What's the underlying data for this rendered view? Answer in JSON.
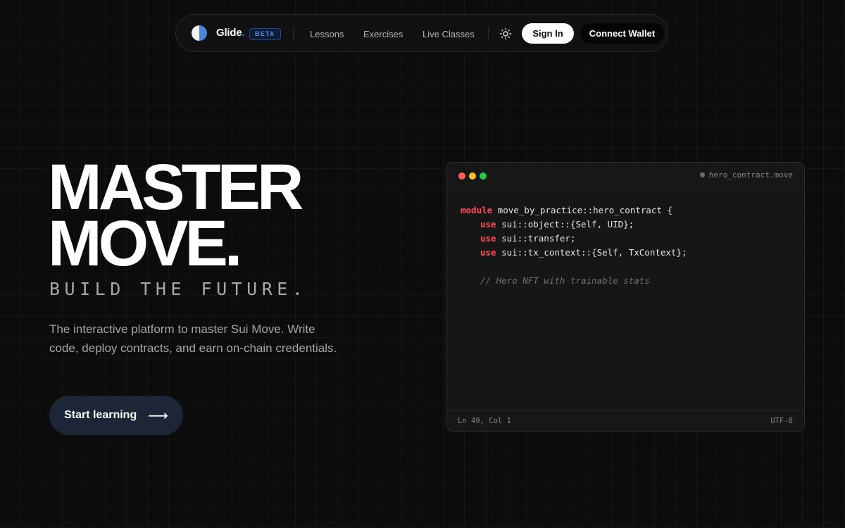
{
  "nav": {
    "brand": "Glide",
    "brand_dot": ".",
    "badge": "BETA",
    "links": [
      "Lessons",
      "Exercises",
      "Live Classes"
    ],
    "theme_icon": "sun-icon",
    "sign_in": "Sign In",
    "connect_wallet": "Connect Wallet"
  },
  "hero": {
    "title_line1": "MASTER",
    "title_line2": "MOVE.",
    "subtitle": "BUILD THE FUTURE.",
    "description": "The interactive platform to master Sui Move. Write code, deploy contracts, and earn on-chain credentials.",
    "cta_label": "Start learning",
    "cta_arrow": "⟶"
  },
  "editor": {
    "filename": "hero_contract.move",
    "lines": [
      {
        "kw": "module",
        "text": " move_by_practice::hero_contract {"
      },
      {
        "kw": "use",
        "text": " sui::object::{Self, UID};"
      },
      {
        "kw": "use",
        "text": " sui::transfer;"
      },
      {
        "kw": "use",
        "text": " sui::tx_context::{Self, TxContext};"
      }
    ],
    "comment": "// Hero NFT with trainable stats",
    "cursor_position": "Ln 49, Col 1",
    "encoding": "UTF-8"
  },
  "colors": {
    "background": "#0c0c0c",
    "accent_blue": "#4a86d8",
    "keyword_red": "#ff4d5e",
    "cta_bg": "#1c2637",
    "dot_red": "#ff5f57",
    "dot_yellow": "#febc2e",
    "dot_green": "#28c840"
  }
}
